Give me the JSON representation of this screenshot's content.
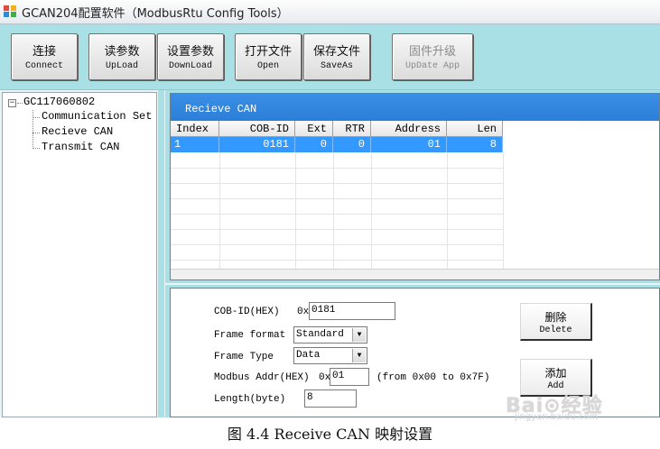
{
  "window": {
    "title": "GCAN204配置软件（ModbusRtu Config Tools）"
  },
  "toolbar": {
    "buttons": [
      {
        "cn": "连接",
        "en": "Connect"
      },
      {
        "cn": "读参数",
        "en": "UpLoad"
      },
      {
        "cn": "设置参数",
        "en": "DownLoad"
      },
      {
        "cn": "打开文件",
        "en": "Open"
      },
      {
        "cn": "保存文件",
        "en": "SaveAs"
      },
      {
        "cn": "固件升级",
        "en": "UpDate App",
        "disabled": true
      }
    ]
  },
  "tree": {
    "root": "GC117060802",
    "expander": "−",
    "items": [
      "Communication Set",
      "Recieve CAN",
      "Transmit CAN"
    ]
  },
  "grid": {
    "title": "Recieve CAN",
    "columns": [
      "Index",
      "COB-ID",
      "Ext",
      "RTR",
      "Address",
      "Len"
    ],
    "rows": [
      [
        "1",
        "0181",
        "0",
        "0",
        "01",
        "8"
      ]
    ]
  },
  "form": {
    "cobid_label": "COB-ID(HEX)",
    "cobid_prefix": "0x",
    "cobid_value": "0181",
    "frame_format_label": "Frame format",
    "frame_format_value": "Standard",
    "frame_type_label": "Frame Type",
    "frame_type_value": "Data",
    "modbus_addr_label": "Modbus Addr(HEX)",
    "modbus_addr_prefix": "0x",
    "modbus_addr_value": "01",
    "modbus_addr_hint": "(from 0x00 to 0x7F)",
    "length_label": "Length(byte)",
    "length_value": "8",
    "delete_cn": "删除",
    "delete_en": "Delete",
    "add_cn": "添加",
    "add_en": "Add"
  },
  "caption": "图 4.4 Receive CAN 映射设置",
  "watermark": {
    "main": "Bai⊙经验",
    "sub": "jingyan.baidu.com"
  },
  "colors": {
    "selection": "#3399ff",
    "grid_header": "#2c7fd6",
    "toolbar": "#a8e0e6"
  }
}
